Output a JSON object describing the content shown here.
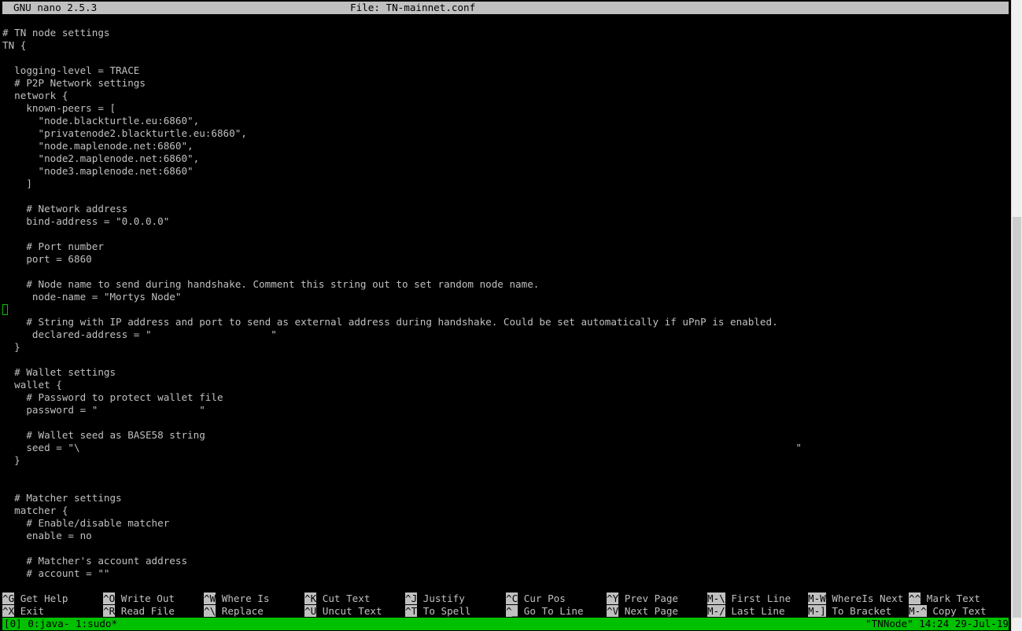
{
  "titlebar": {
    "app": "GNU nano 2.5.3",
    "file": "File: TN-mainnet.conf"
  },
  "editor": {
    "lines": [
      "# TN node settings",
      "TN {",
      "",
      "  logging-level = TRACE",
      "  # P2P Network settings",
      "  network {",
      "    known-peers = [",
      "      \"node.blackturtle.eu:6860\",",
      "      \"privatenode2.blackturtle.eu:6860\",",
      "      \"node.maplenode.net:6860\",",
      "      \"node2.maplenode.net:6860\",",
      "      \"node3.maplenode.net:6860\"",
      "    ]",
      "",
      "    # Network address",
      "    bind-address = \"0.0.0.0\"",
      "",
      "    # Port number",
      "    port = 6860",
      "",
      "    # Node name to send during handshake. Comment this string out to set random node name.",
      "     node-name = \"Mortys Node\"",
      "",
      "    # String with IP address and port to send as external address during handshake. Could be set automatically if uPnP is enabled.",
      "     declared-address = \"                    \"",
      "  }",
      "",
      "  # Wallet settings",
      "  wallet {",
      "    # Password to protect wallet file",
      "    password = \"                 \"",
      "",
      "    # Wallet seed as BASE58 string",
      "    seed = \"\\                                                                                                                        \"",
      "  }",
      "",
      "",
      "  # Matcher settings",
      "  matcher {",
      "    # Enable/disable matcher",
      "    enable = no",
      "",
      "    # Matcher's account address",
      "    # account = \"\""
    ]
  },
  "shortcuts": [
    [
      {
        "key": "^G",
        "label": " Get Help"
      },
      {
        "key": "^O",
        "label": " Write Out"
      },
      {
        "key": "^W",
        "label": " Where Is"
      },
      {
        "key": "^K",
        "label": " Cut Text"
      },
      {
        "key": "^J",
        "label": " Justify"
      },
      {
        "key": "^C",
        "label": " Cur Pos"
      },
      {
        "key": "^Y",
        "label": " Prev Page"
      },
      {
        "key": "M-\\",
        "label": " First Line"
      },
      {
        "key": "M-W",
        "label": " WhereIs Next"
      },
      {
        "key": "^^",
        "label": " Mark Text"
      }
    ],
    [
      {
        "key": "^X",
        "label": " Exit"
      },
      {
        "key": "^R",
        "label": " Read File"
      },
      {
        "key": "^\\",
        "label": " Replace"
      },
      {
        "key": "^U",
        "label": " Uncut Text"
      },
      {
        "key": "^T",
        "label": " To Spell"
      },
      {
        "key": "^_",
        "label": " Go To Line"
      },
      {
        "key": "^V",
        "label": " Next Page"
      },
      {
        "key": "M-/",
        "label": " Last Line"
      },
      {
        "key": "M-]",
        "label": " To Bracket"
      },
      {
        "key": "M-^",
        "label": " Copy Text"
      }
    ]
  ],
  "statusbar": {
    "left": "[0] 0:java- 1:sudo*",
    "right": "\"TNNode\" 14:24 29-Jul-19"
  },
  "colors": {
    "terminal_bg": "#000000",
    "text": "#c0c0c0",
    "title_bg": "#c0c0c0",
    "status_bg": "#00c000",
    "cursor": "#00c000"
  }
}
